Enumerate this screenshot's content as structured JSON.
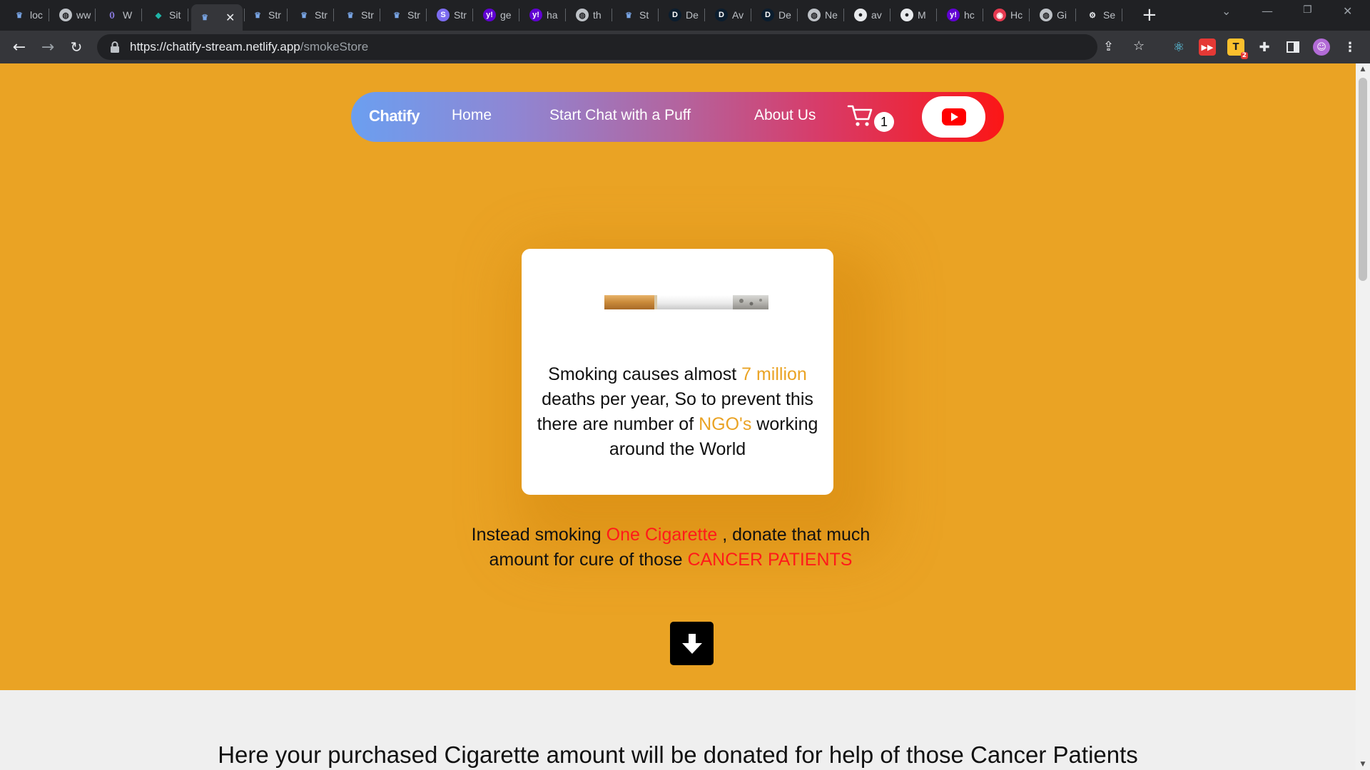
{
  "browser": {
    "tabs": [
      {
        "label": "loc",
        "icon": "crown-icon"
      },
      {
        "label": "ww",
        "icon": "globe-icon"
      },
      {
        "label": "W",
        "icon": "wasm-icon"
      },
      {
        "label": "Sit",
        "icon": "diamond-icon"
      },
      {
        "label": "",
        "icon": "crown-icon",
        "active": true
      },
      {
        "label": "Str",
        "icon": "crown-icon"
      },
      {
        "label": "Str",
        "icon": "crown-icon"
      },
      {
        "label": "Str",
        "icon": "crown-icon"
      },
      {
        "label": "Str",
        "icon": "crown-icon"
      },
      {
        "label": "Str",
        "icon": "s-logo-icon"
      },
      {
        "label": "ge",
        "icon": "yahoo-icon"
      },
      {
        "label": "ha",
        "icon": "yahoo-icon"
      },
      {
        "label": "th",
        "icon": "globe-icon"
      },
      {
        "label": "St",
        "icon": "crown-icon"
      },
      {
        "label": "De",
        "icon": "d-logo-icon"
      },
      {
        "label": "Av",
        "icon": "d-logo-icon"
      },
      {
        "label": "De",
        "icon": "d-logo-icon"
      },
      {
        "label": "Ne",
        "icon": "globe-icon"
      },
      {
        "label": "av",
        "icon": "github-icon"
      },
      {
        "label": "M",
        "icon": "github-icon"
      },
      {
        "label": "hc",
        "icon": "yahoo-icon"
      },
      {
        "label": "Hc",
        "icon": "record-icon"
      },
      {
        "label": "Gi",
        "icon": "globe-icon"
      },
      {
        "label": "Se",
        "icon": "gear-icon"
      }
    ],
    "url_host": "https://chatify-stream.netlify.app",
    "url_path": "/smokeStore",
    "extension_badge": "2"
  },
  "nav": {
    "brand": "Chatify",
    "home": "Home",
    "start_chat": "Start Chat with a Puff",
    "about": "About Us",
    "cart_count": "1"
  },
  "card": {
    "text_1": "Smoking causes almost ",
    "highlight_1": "7 million",
    "text_2": " deaths per year, So to prevent this there are number of ",
    "highlight_2": "NGO's",
    "text_3": " working around the World"
  },
  "donate": {
    "text_1": "Instead smoking ",
    "highlight_1": "One Cigarette",
    "text_2": " , donate that much amount for cure of those ",
    "highlight_2": "CANCER PATIENTS"
  },
  "lower": {
    "heading": "Here your purchased Cigarette amount will be donated for help of those Cancer Patients"
  },
  "colors": {
    "page_bg": "#eaa324",
    "highlight_orange": "#eaa324",
    "highlight_red": "#ff1a1a",
    "lower_bg": "#efefef"
  }
}
